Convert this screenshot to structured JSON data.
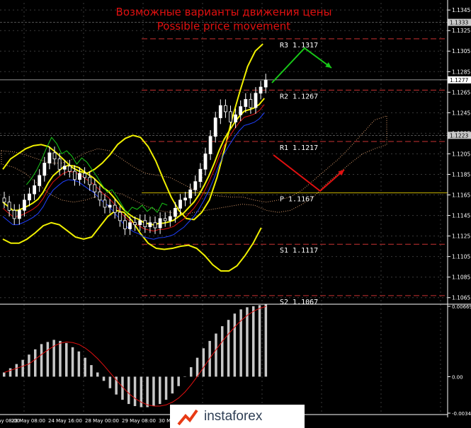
{
  "chart_title": {
    "ru": "Возможные варианты движения цены",
    "en": "Possible price movement"
  },
  "price_axis": {
    "ticks": [
      "1.1345",
      "1.1325",
      "1.1305",
      "1.1285",
      "1.1265",
      "1.1245",
      "1.1225",
      "1.1205",
      "1.1185",
      "1.1165",
      "1.1145",
      "1.1125",
      "1.1105",
      "1.1085",
      "1.1065"
    ],
    "markers": [
      {
        "label": "1.1333",
        "kind": "badge"
      },
      {
        "label": "1.1277",
        "kind": "current"
      },
      {
        "label": "1.1223",
        "kind": "badge"
      }
    ]
  },
  "time_axis": {
    "ticks": [
      "23 May 08:00",
      "23 May 08:00",
      "24 May 16:00",
      "28 May 00:00",
      "29 May 08:00",
      "30 Ma"
    ]
  },
  "chart_data": {
    "type": "line",
    "instrument_chart": "candlestick with Bollinger bands, Ichimoku cloud and MACD",
    "y_range": [
      1.106,
      1.1352
    ],
    "levels": [
      {
        "name": "R3",
        "value": 1.1317,
        "label": "R3  1.1317",
        "style": "dashed",
        "color": "#c83232"
      },
      {
        "name": "R2",
        "value": 1.1267,
        "label": "R2  1.1267",
        "style": "dashed",
        "color": "#c83232"
      },
      {
        "name": "R1",
        "value": 1.1217,
        "label": "R1  1.1217",
        "style": "dashed",
        "color": "#c83232"
      },
      {
        "name": "P",
        "value": 1.1167,
        "label": "P  1.1167",
        "style": "solid",
        "color": "#c8b400"
      },
      {
        "name": "S1",
        "value": 1.1117,
        "label": "S1  1.1117",
        "style": "dashed",
        "color": "#c83232"
      },
      {
        "name": "S2",
        "value": 1.1067,
        "label": "S2  1.1067",
        "style": "dashed",
        "color": "#c83232"
      }
    ],
    "close": [
      1.1158,
      1.115,
      1.1142,
      1.115,
      1.116,
      1.1166,
      1.1174,
      1.1184,
      1.1196,
      1.1206,
      1.12,
      1.119,
      1.1193,
      1.1188,
      1.118,
      1.1186,
      1.1182,
      1.1175,
      1.1168,
      1.116,
      1.1153,
      1.1155,
      1.1148,
      1.114,
      1.1132,
      1.1138,
      1.1136,
      1.114,
      1.1134,
      1.1138,
      1.1133,
      1.1142,
      1.114,
      1.1144,
      1.1152,
      1.116,
      1.1162,
      1.117,
      1.1178,
      1.119,
      1.1205,
      1.1222,
      1.124,
      1.1252,
      1.1246,
      1.1236,
      1.1243,
      1.1251,
      1.1258,
      1.125,
      1.1264,
      1.127,
      1.1277
    ],
    "bollinger_upper": [
      1.119,
      1.12,
      1.1205,
      1.121,
      1.1213,
      1.1214,
      1.1212,
      1.1206,
      1.1199,
      1.1192,
      1.1188,
      1.1186,
      1.119,
      1.1196,
      1.1204,
      1.1214,
      1.122,
      1.1223,
      1.1221,
      1.1212,
      1.1198,
      1.118,
      1.1163,
      1.115,
      1.1142,
      1.1141,
      1.1148,
      1.116,
      1.1182,
      1.121,
      1.124,
      1.1266,
      1.129,
      1.1305,
      1.1312
    ],
    "bollinger_lower": [
      1.1122,
      1.1118,
      1.1118,
      1.1122,
      1.1128,
      1.1135,
      1.1138,
      1.1136,
      1.113,
      1.1124,
      1.1122,
      1.1124,
      1.1134,
      1.1144,
      1.115,
      1.1148,
      1.114,
      1.1128,
      1.1118,
      1.1113,
      1.1112,
      1.1113,
      1.1115,
      1.1116,
      1.1113,
      1.1106,
      1.1097,
      1.1091,
      1.1091,
      1.1096,
      1.1106,
      1.1118,
      1.1133
    ],
    "macd_hist": [
      0.0004,
      0.0008,
      0.0012,
      0.0016,
      0.0021,
      0.0026,
      0.0031,
      0.0033,
      0.0035,
      0.0034,
      0.0032,
      0.0028,
      0.0024,
      0.0018,
      0.0011,
      0.0004,
      -0.0004,
      -0.0011,
      -0.0017,
      -0.0022,
      -0.0026,
      -0.0028,
      -0.0029,
      -0.0029,
      -0.0028,
      -0.0026,
      -0.0022,
      -0.0016,
      -0.0009,
      0.0,
      0.0009,
      0.0018,
      0.0027,
      0.0034,
      0.0041,
      0.0048,
      0.0054,
      0.006,
      0.0064,
      0.0066,
      0.0067,
      0.0068,
      0.0069
    ],
    "macd_axis": {
      "ticks": [
        "0.00669",
        "0.00",
        "-0.00347"
      ]
    },
    "legend": "none",
    "grid": true
  },
  "forecast": [
    {
      "name": "bullish-scenario",
      "color": "#18c818"
    },
    {
      "name": "bearish-scenario",
      "color": "#e01010"
    }
  ],
  "logo": {
    "text": "instaforex"
  },
  "colors": {
    "background": "#000000",
    "axis_text": "#ffffff",
    "bands": "#f0f000",
    "candle": "#ffffff",
    "badge_bg": "#c8c8c8"
  }
}
